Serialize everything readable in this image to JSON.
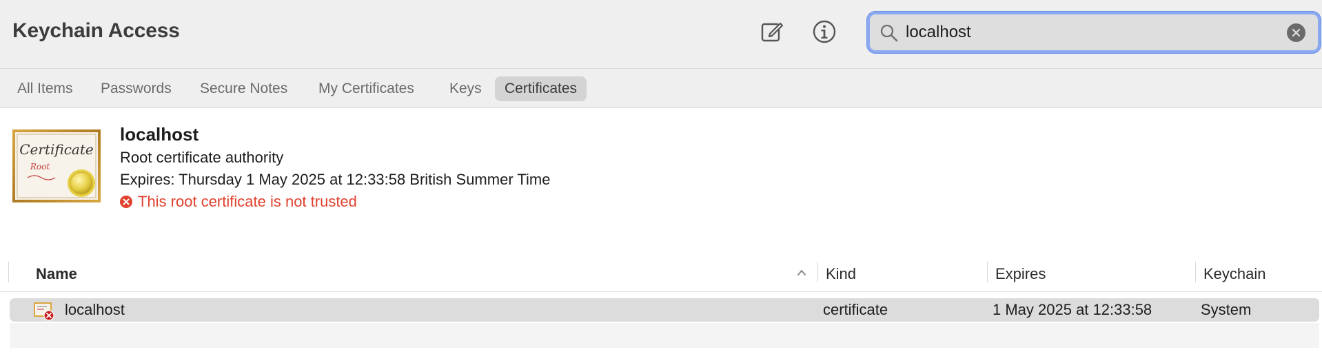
{
  "app": {
    "title": "Keychain Access"
  },
  "toolbar": {
    "compose_icon": "compose-icon",
    "info_icon": "info-icon"
  },
  "search": {
    "value": "localhost",
    "icon": "search-icon",
    "clear_icon": "clear-icon"
  },
  "tabs": [
    {
      "label": "All Items",
      "active": false
    },
    {
      "label": "Passwords",
      "active": false
    },
    {
      "label": "Secure Notes",
      "active": false
    },
    {
      "label": "My Certificates",
      "active": false
    },
    {
      "label": "Keys",
      "active": false
    },
    {
      "label": "Certificates",
      "active": true
    }
  ],
  "detail": {
    "name": "localhost",
    "subtitle": "Root certificate authority",
    "expires": "Expires: Thursday 1 May 2025 at 12:33:58 British Summer Time",
    "warning": "This root certificate is not trusted",
    "cert_image": {
      "title_text": "Certificate",
      "sub_text": "Root"
    }
  },
  "table": {
    "columns": {
      "name": "Name",
      "kind": "Kind",
      "expires": "Expires",
      "keychain": "Keychain"
    },
    "rows": [
      {
        "name": "localhost",
        "kind": "certificate",
        "expires": "1 May 2025 at 12:33:58",
        "keychain": "System",
        "selected": true
      }
    ]
  },
  "colors": {
    "accent": "#3b6fe0",
    "warning": "#e0412f",
    "selection": "#dcdcdc"
  }
}
